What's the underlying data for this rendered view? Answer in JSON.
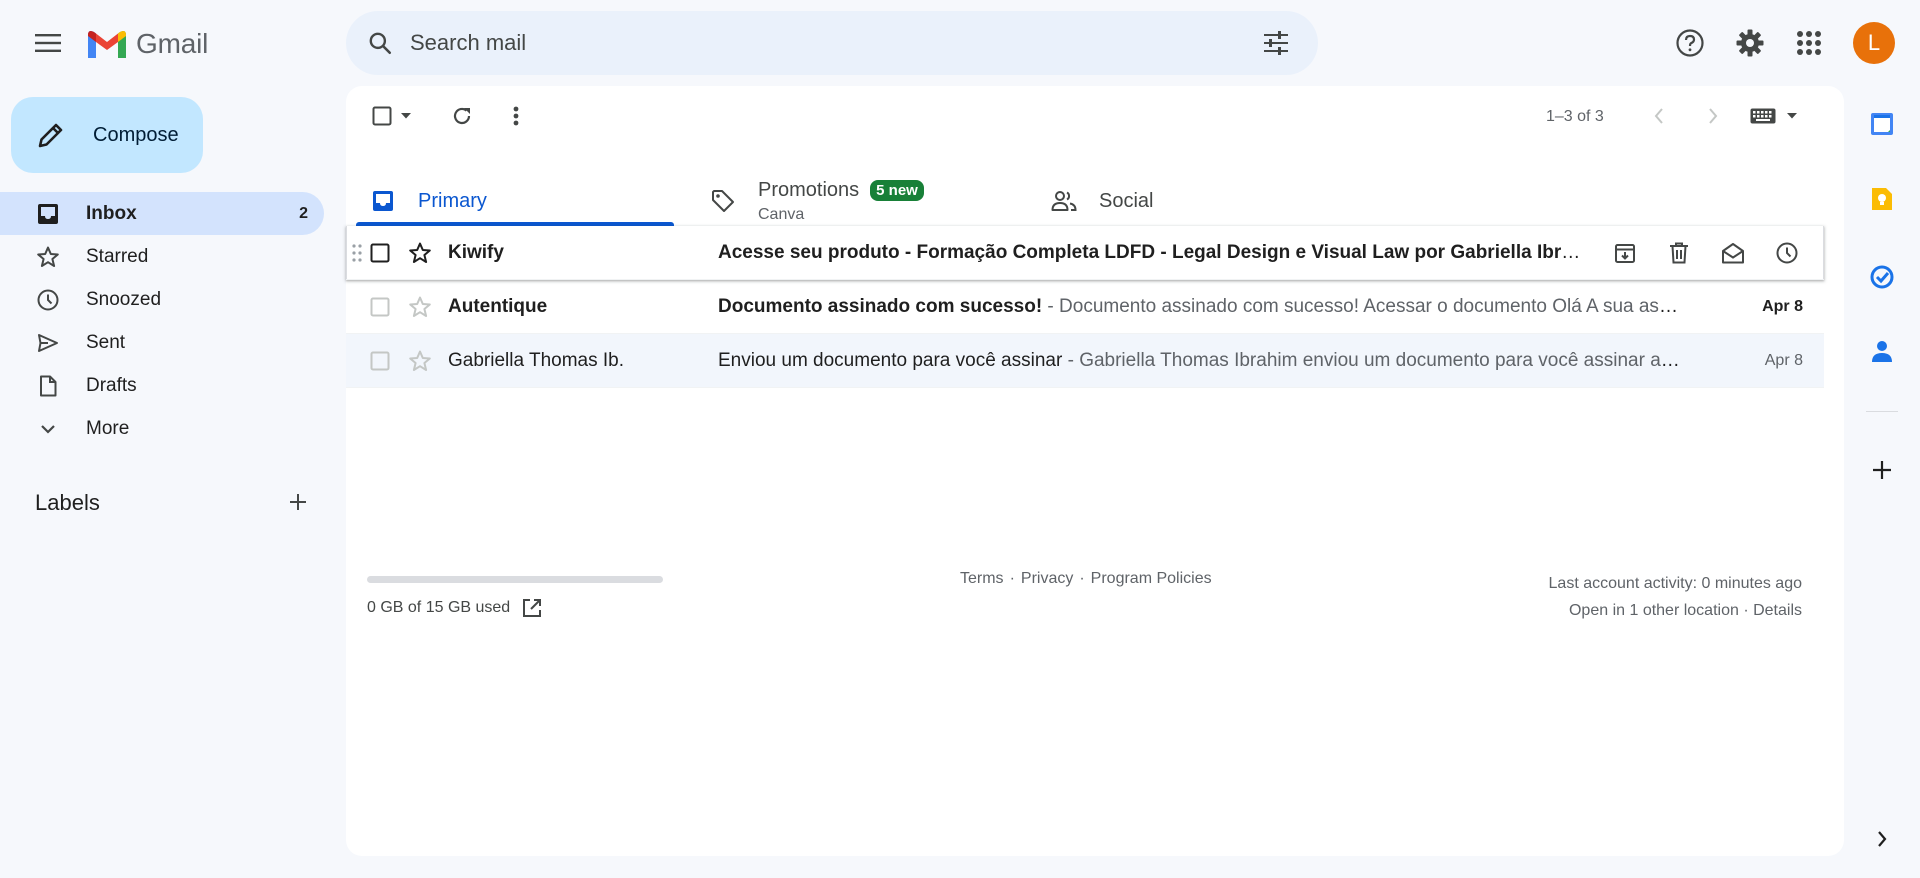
{
  "header": {
    "app_name": "Gmail",
    "search_placeholder": "Search mail",
    "avatar_letter": "L"
  },
  "compose_label": "Compose",
  "nav": [
    {
      "label": "Inbox",
      "count": "2",
      "icon": "inbox-icon"
    },
    {
      "label": "Starred",
      "count": "",
      "icon": "star-icon"
    },
    {
      "label": "Snoozed",
      "count": "",
      "icon": "clock-icon"
    },
    {
      "label": "Sent",
      "count": "",
      "icon": "send-icon"
    },
    {
      "label": "Drafts",
      "count": "",
      "icon": "draft-icon"
    },
    {
      "label": "More",
      "count": "",
      "icon": "chevron-down-icon"
    }
  ],
  "labels_heading": "Labels",
  "toolbar": {
    "pager": "1–3 of 3"
  },
  "tabs": {
    "primary": "Primary",
    "promotions": "Promotions",
    "promotions_badge": "5 new",
    "promotions_sub": "Canva",
    "social": "Social"
  },
  "emails": [
    {
      "sender": "Kiwify",
      "subject": "Acesse seu produto - Formação Completa LDFD - Legal Design e Visual Law por Gabriella Ibrahim",
      "snippet": "",
      "date": "",
      "unread": true
    },
    {
      "sender": "Autentique",
      "subject": "Documento assinado com sucesso!",
      "snippet": " - Documento assinado com sucesso! Acessar o documento Olá A sua assinatura foi registrada",
      "date": "Apr 8",
      "unread": true
    },
    {
      "sender": "Gabriella Thomas Ib.",
      "subject": "Enviou um documento para você assinar",
      "snippet": " - Gabriella Thomas Ibrahim enviou um documento para você assinar através da Autentique",
      "date": "Apr 8",
      "unread": false
    }
  ],
  "footer": {
    "storage": "0 GB of 15 GB used",
    "storage_fraction": 0.0,
    "link_terms": "Terms",
    "link_privacy": "Privacy",
    "link_policies": "Program Policies",
    "separator": "·",
    "activity": "Last account activity: 0 minutes ago",
    "locations": "Open in 1 other location · Details"
  },
  "colors": {
    "accent": "#0b57d0",
    "compose_bg": "#c2e7ff",
    "nav_active": "#d3e3fd",
    "badge": "#188038",
    "avatar": "#e8710a"
  }
}
